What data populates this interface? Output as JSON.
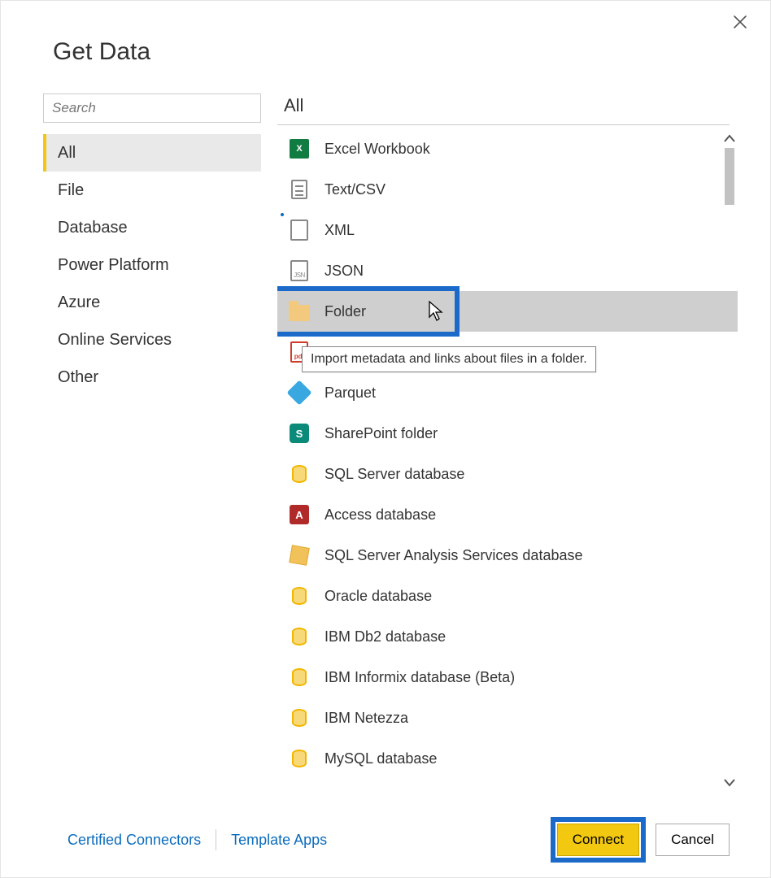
{
  "dialog": {
    "title": "Get Data",
    "close_tooltip": "Close"
  },
  "search": {
    "placeholder": "Search",
    "value": ""
  },
  "categories": [
    {
      "key": "all",
      "label": "All",
      "selected": true
    },
    {
      "key": "file",
      "label": "File",
      "selected": false
    },
    {
      "key": "database",
      "label": "Database",
      "selected": false
    },
    {
      "key": "power-platform",
      "label": "Power Platform",
      "selected": false
    },
    {
      "key": "azure",
      "label": "Azure",
      "selected": false
    },
    {
      "key": "online-services",
      "label": "Online Services",
      "selected": false
    },
    {
      "key": "other",
      "label": "Other",
      "selected": false
    }
  ],
  "connectors": {
    "header": "All",
    "selected_key": "folder",
    "tooltip_text": "Import metadata and links about files in a folder.",
    "items": [
      {
        "key": "excel",
        "label": "Excel Workbook",
        "icon": "excel-icon"
      },
      {
        "key": "text-csv",
        "label": "Text/CSV",
        "icon": "doc-icon"
      },
      {
        "key": "xml",
        "label": "XML",
        "icon": "xml-icon"
      },
      {
        "key": "json",
        "label": "JSON",
        "icon": "json-icon"
      },
      {
        "key": "folder",
        "label": "Folder",
        "icon": "folder-icon"
      },
      {
        "key": "pdf",
        "label": "PDF",
        "icon": "pdf-icon"
      },
      {
        "key": "parquet",
        "label": "Parquet",
        "icon": "parquet-icon"
      },
      {
        "key": "sp-folder",
        "label": "SharePoint folder",
        "icon": "sharepoint-icon"
      },
      {
        "key": "sql-server",
        "label": "SQL Server database",
        "icon": "database-icon"
      },
      {
        "key": "access",
        "label": "Access database",
        "icon": "access-icon"
      },
      {
        "key": "ssas",
        "label": "SQL Server Analysis Services database",
        "icon": "cube-icon"
      },
      {
        "key": "oracle",
        "label": "Oracle database",
        "icon": "database-icon"
      },
      {
        "key": "db2",
        "label": "IBM Db2 database",
        "icon": "database-icon"
      },
      {
        "key": "informix",
        "label": "IBM Informix database (Beta)",
        "icon": "database-icon"
      },
      {
        "key": "netezza",
        "label": "IBM Netezza",
        "icon": "database-icon"
      },
      {
        "key": "mysql",
        "label": "MySQL database",
        "icon": "database-icon"
      }
    ]
  },
  "footer": {
    "certified_label": "Certified Connectors",
    "template_label": "Template Apps",
    "connect_label": "Connect",
    "cancel_label": "Cancel"
  },
  "highlights": {
    "folder_item": true,
    "connect_button": true
  }
}
